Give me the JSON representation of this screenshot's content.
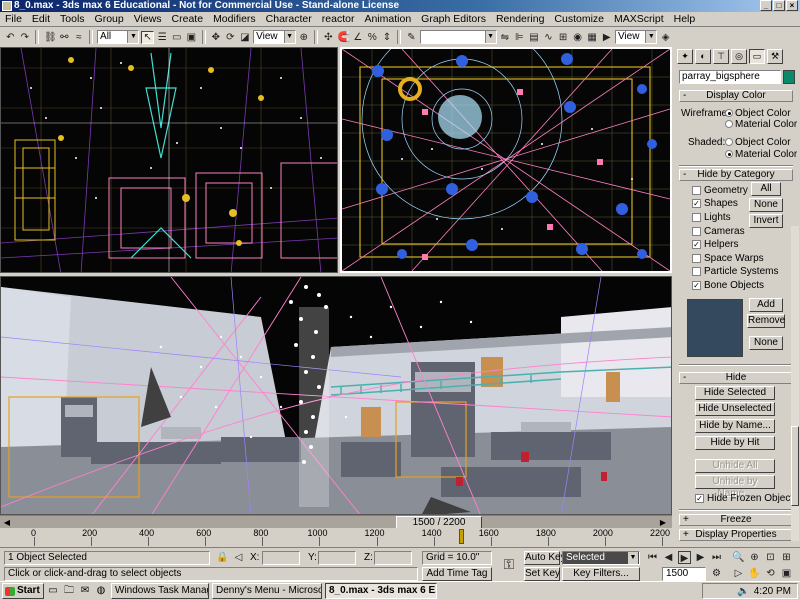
{
  "window": {
    "title": "8_0.max - 3ds max 6 Educational - Not for Commercial Use - Stand-alone License"
  },
  "menu": [
    "File",
    "Edit",
    "Tools",
    "Group",
    "Views",
    "Create",
    "Modifiers",
    "Character",
    "reactor",
    "Animation",
    "Graph Editors",
    "Rendering",
    "Customize",
    "MAXScript",
    "Help"
  ],
  "toolbar": {
    "selection_filter": "All",
    "ref_coord": "View",
    "named_selection": "",
    "view_dropdown2": "View"
  },
  "command_panel": {
    "object_name": "parray_bigsphere",
    "object_color": "#0a8a6a",
    "display_color": {
      "title": "Display Color",
      "wireframe_label": "Wireframe:",
      "shaded_label": "Shaded:",
      "object_color": "Object Color",
      "material_color": "Material Color"
    },
    "hide_by_category": {
      "title": "Hide by Category",
      "items": [
        "Geometry",
        "Shapes",
        "Lights",
        "Cameras",
        "Helpers",
        "Space Warps",
        "Particle Systems",
        "Bone Objects"
      ],
      "checked": [
        false,
        true,
        false,
        false,
        true,
        false,
        false,
        true
      ],
      "buttons": {
        "all": "All",
        "none": "None",
        "invert": "Invert"
      },
      "list_buttons": {
        "add": "Add",
        "remove": "Remove",
        "none": "None"
      }
    },
    "hide": {
      "title": "Hide",
      "buttons": [
        "Hide Selected",
        "Hide Unselected",
        "Hide by Name...",
        "Hide by Hit"
      ],
      "disabled_buttons": [
        "Unhide All",
        "Unhide by Name..."
      ],
      "hide_frozen": "Hide Frozen Objects"
    },
    "freeze": {
      "title": "Freeze"
    },
    "display_properties": {
      "title": "Display Properties"
    },
    "rollup_collapsed": "+",
    "rollup_expanded": "-"
  },
  "timeline": {
    "position": "1500 / 2200",
    "current_frame": 1500,
    "total_frames": 2200,
    "ticks": [
      "0",
      "200",
      "400",
      "600",
      "800",
      "1000",
      "1200",
      "1400",
      "1600",
      "1800",
      "2000",
      "2200"
    ]
  },
  "status": {
    "selection": "1 Object Selected",
    "prompt": "Click or click-and-drag to select objects",
    "x_label": "X:",
    "y_label": "Y:",
    "z_label": "Z:",
    "grid": "Grid = 10.0\"",
    "add_time_tag": "Add Time Tag",
    "auto_key": "Auto Key",
    "set_key": "Set Key",
    "key_mode": "Selected",
    "key_filters": "Key Filters...",
    "frame": "1500"
  },
  "taskbar": {
    "start": "Start",
    "tasks": [
      "Windows Task Manager",
      "Denny's Menu - Microsoft ...",
      "8_0.max - 3ds max 6 E..."
    ],
    "clock": "4:20 PM"
  }
}
